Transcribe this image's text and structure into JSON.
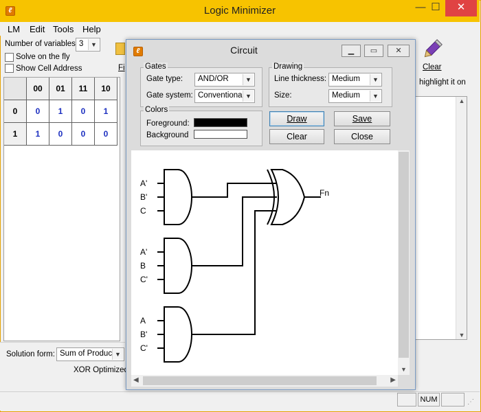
{
  "app": {
    "title": "Logic Minimizer",
    "icon": "lm-app-icon",
    "window_buttons": [
      "minimize-icon",
      "maximize-icon",
      "close-icon"
    ]
  },
  "menu": [
    "LM",
    "Edit",
    "Tools",
    "Help"
  ],
  "options": {
    "num_vars_label": "Number of variables:",
    "num_vars_value": "3",
    "solve_on_fly_label": "Solve on the fly",
    "solve_on_fly_checked": false,
    "show_cell_address_label": "Show Cell Address",
    "show_cell_address_checked": false
  },
  "kmap": {
    "col_headers": [
      "00",
      "01",
      "11",
      "10"
    ],
    "row_headers": [
      "0",
      "1"
    ],
    "rows": [
      [
        "0",
        "1",
        "0",
        "1"
      ],
      [
        "1",
        "0",
        "0",
        "0"
      ]
    ]
  },
  "toolbar": {
    "clear_label": "Clear",
    "partial_label": "Fi"
  },
  "right_panel": {
    "text": "highlight it on"
  },
  "solution": {
    "form_label": "Solution form:",
    "form_value": "Sum of Product",
    "xor_label": "XOR Optimized:"
  },
  "status": {
    "num": "NUM"
  },
  "circuit": {
    "title": "Circuit",
    "gates_group": "Gates",
    "gate_type_label": "Gate type:",
    "gate_type_value": "AND/OR",
    "gate_system_label": "Gate system:",
    "gate_system_value": "Conventional",
    "drawing_group": "Drawing",
    "line_thickness_label": "Line thickness:",
    "line_thickness_value": "Medium",
    "size_label": "Size:",
    "size_value": "Medium",
    "colors_group": "Colors",
    "foreground_label": "Foreground:",
    "foreground_color": "#000000",
    "background_label": "Background",
    "background_color": "#ffffff",
    "buttons": {
      "draw": "Draw",
      "save": "Save",
      "clear": "Clear",
      "close": "Close"
    },
    "diagram": {
      "and1_inputs": [
        "A'",
        "B'",
        "C"
      ],
      "and2_inputs": [
        "A'",
        "B",
        "C'"
      ],
      "and3_inputs": [
        "A",
        "B'",
        "C'"
      ],
      "output": "Fn"
    }
  }
}
